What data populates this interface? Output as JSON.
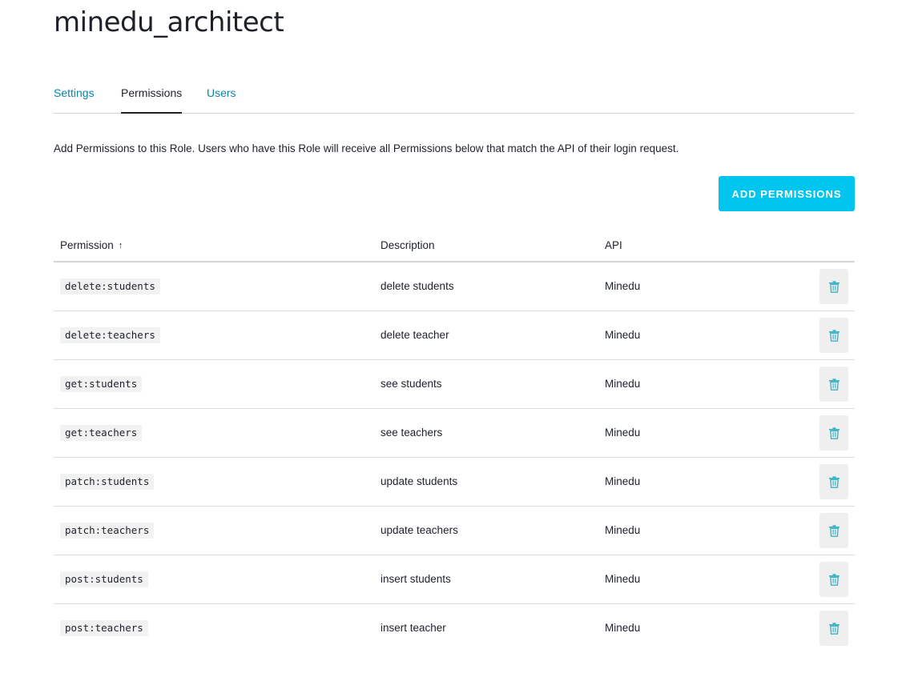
{
  "role": {
    "title": "minedu_architect"
  },
  "tabs": [
    {
      "label": "Settings",
      "active": false
    },
    {
      "label": "Permissions",
      "active": true
    },
    {
      "label": "Users",
      "active": false
    }
  ],
  "intro_text": "Add Permissions to this Role. Users who have this Role will receive all Permissions below that match the API of their login request.",
  "add_button_label": "ADD PERMISSIONS",
  "table": {
    "columns": {
      "permission": "Permission",
      "permission_sort_icon": "arrow-up-icon",
      "description": "Description",
      "api": "API"
    },
    "rows": [
      {
        "permission": "delete:students",
        "description": "delete students",
        "api": "Minedu"
      },
      {
        "permission": "delete:teachers",
        "description": "delete teacher",
        "api": "Minedu"
      },
      {
        "permission": "get:students",
        "description": "see students",
        "api": "Minedu"
      },
      {
        "permission": "get:teachers",
        "description": "see teachers",
        "api": "Minedu"
      },
      {
        "permission": "patch:students",
        "description": "update students",
        "api": "Minedu"
      },
      {
        "permission": "patch:teachers",
        "description": "update teachers",
        "api": "Minedu"
      },
      {
        "permission": "post:students",
        "description": "insert students",
        "api": "Minedu"
      },
      {
        "permission": "post:teachers",
        "description": "insert teacher",
        "api": "Minedu"
      }
    ]
  },
  "colors": {
    "link": "#0a84ae",
    "accent_button": "#00c5ef",
    "trash_icon": "#3cb4c8",
    "text": "#1e212a"
  }
}
